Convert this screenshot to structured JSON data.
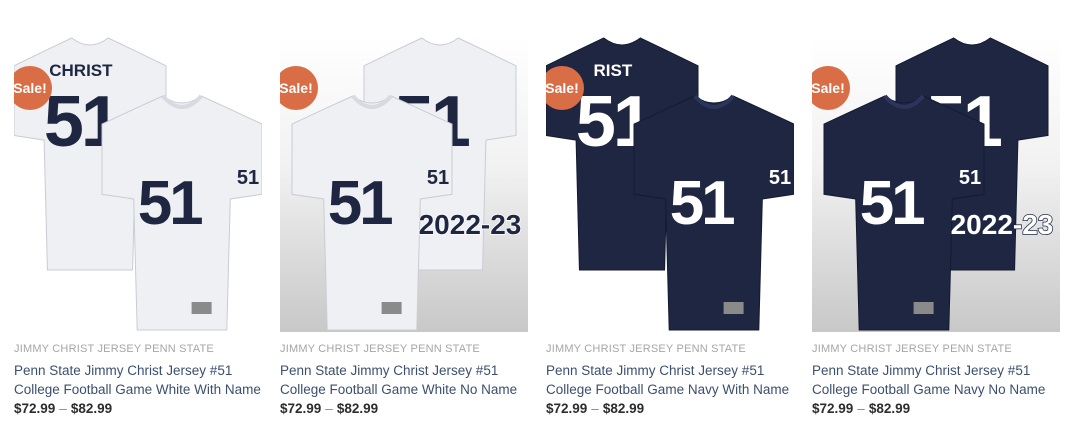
{
  "sale_label": "Sale!",
  "products": [
    {
      "category": "JIMMY CHRIST JERSEY PENN STATE",
      "title": "Penn State Jimmy Christ Jersey #51 College Football Game White With Name",
      "price_min": "$72.99",
      "price_sep": "–",
      "price_max": "$82.99",
      "jersey_color": "white",
      "back_name": "CHRIST",
      "number": "51",
      "patch": "",
      "background": "plain"
    },
    {
      "category": "JIMMY CHRIST JERSEY PENN STATE",
      "title": "Penn State Jimmy Christ Jersey #51 College Football Game White No Name",
      "price_min": "$72.99",
      "price_sep": "–",
      "price_max": "$82.99",
      "jersey_color": "white",
      "back_name": "",
      "number": "51",
      "patch": "2022-23",
      "background": "grad"
    },
    {
      "category": "JIMMY CHRIST JERSEY PENN STATE",
      "title": "Penn State Jimmy Christ Jersey #51 College Football Game Navy With Name",
      "price_min": "$72.99",
      "price_sep": "–",
      "price_max": "$82.99",
      "jersey_color": "navy",
      "back_name": "RIST",
      "number": "51",
      "patch": "",
      "background": "plain"
    },
    {
      "category": "JIMMY CHRIST JERSEY PENN STATE",
      "title": "Penn State Jimmy Christ Jersey #51 College Football Game Navy No Name",
      "price_min": "$72.99",
      "price_sep": "–",
      "price_max": "$82.99",
      "jersey_color": "navy",
      "back_name": "",
      "number": "51",
      "patch": "2022-23",
      "background": "grad"
    }
  ],
  "colors": {
    "sale_badge": "#d96d45",
    "title_link": "#3b4f6e",
    "category": "#a6a6a6",
    "white_jersey": "#eef0f3",
    "navy_jersey": "#1e2642"
  }
}
